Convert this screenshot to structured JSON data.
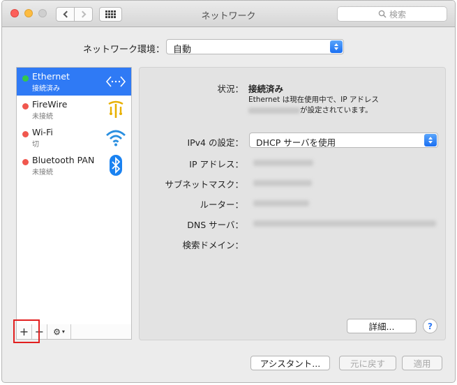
{
  "window": {
    "title": "ネットワーク"
  },
  "search": {
    "placeholder": "検索"
  },
  "location": {
    "label": "ネットワーク環境：",
    "value": "自動"
  },
  "services": [
    {
      "name": "Ethernet",
      "status": "接続済み",
      "dot": "#34c84a",
      "icon": "ethernet-arrows-icon",
      "selected": true
    },
    {
      "name": "FireWire",
      "status": "未接続",
      "dot": "#f0574e",
      "icon": "firewire-icon",
      "selected": false
    },
    {
      "name": "Wi-Fi",
      "status": "切",
      "dot": "#f0574e",
      "icon": "wifi-icon",
      "selected": false
    },
    {
      "name": "Bluetooth PAN",
      "status": "未接続",
      "dot": "#f0574e",
      "icon": "bluetooth-icon",
      "selected": false
    }
  ],
  "toolbar": {
    "add": "+",
    "remove": "−",
    "gear": "⚙"
  },
  "detail": {
    "status_label": "状況：",
    "status_value": "接続済み",
    "status_desc_1": "Ethernet は現在使用中で、IP アドレス",
    "status_desc_2": "が設定されています。",
    "ipv4_label": "IPv4 の設定：",
    "ipv4_value": "DHCP サーバを使用",
    "ip_label": "IP アドレス：",
    "subnet_label": "サブネットマスク：",
    "router_label": "ルーター：",
    "dns_label": "DNS サーバ：",
    "search_domain_label": "検索ドメイン："
  },
  "buttons": {
    "advanced": "詳細...",
    "help": "?",
    "assistant": "アシスタント...",
    "revert": "元に戻す",
    "apply": "適用"
  },
  "colors": {
    "accent": "#2f7af5",
    "highlight": "#e21f1f"
  }
}
